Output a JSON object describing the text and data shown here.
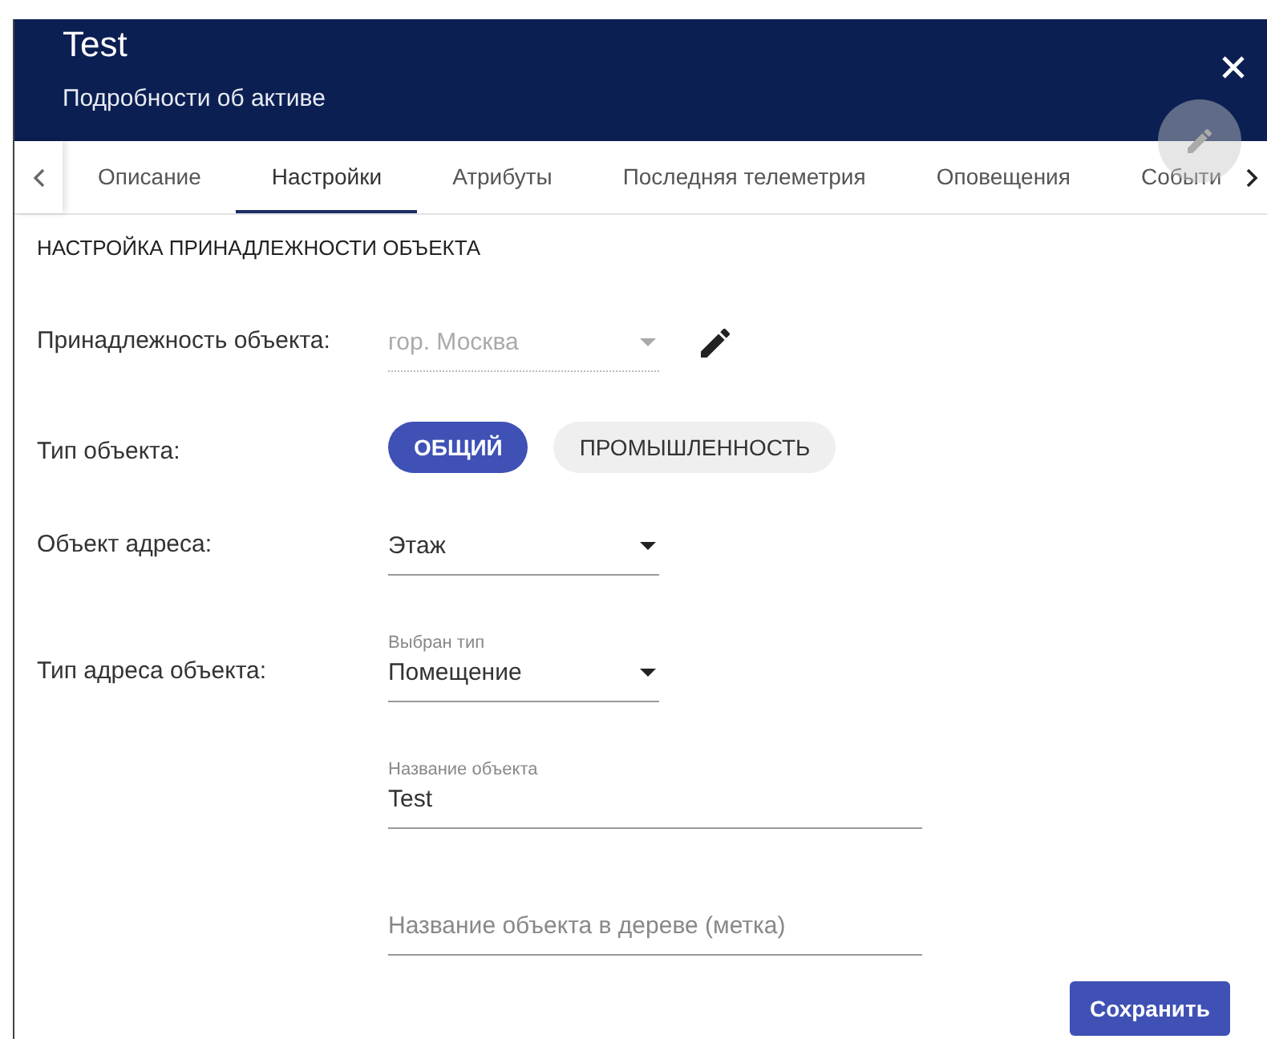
{
  "header": {
    "title": "Test",
    "subtitle": "Подробности об активе"
  },
  "tabs": [
    {
      "label": "Описание",
      "selected": false
    },
    {
      "label": "Настройки",
      "selected": true
    },
    {
      "label": "Атрибуты",
      "selected": false
    },
    {
      "label": "Последняя телеметрия",
      "selected": false
    },
    {
      "label": "Оповещения",
      "selected": false
    },
    {
      "label": "Событи",
      "selected": false
    }
  ],
  "section_title": "НАСТРОЙКА ПРИНАДЛЕЖНОСТИ ОБЪЕКТА",
  "rows": [
    {
      "kind": "select",
      "label": "Принадлежность объекта:",
      "value": "гор. Москва",
      "disabled": true,
      "editable": true
    },
    {
      "kind": "chips",
      "label": "Тип объекта:",
      "options": [
        {
          "label": "ОБЩИЙ",
          "selected": true
        },
        {
          "label": "ПРОМЫШЛЕННОСТЬ",
          "selected": false
        }
      ]
    },
    {
      "kind": "select",
      "label": "Объект адреса:",
      "value": "Этаж",
      "disabled": false
    },
    {
      "kind": "select",
      "label": "Тип адреса объекта:",
      "floating_label": "Выбран тип",
      "value": "Помещение",
      "disabled": false
    },
    {
      "kind": "text",
      "floating_label": "Название объекта",
      "value": "Test"
    },
    {
      "kind": "text",
      "placeholder": "Название объекта в дереве (метка)"
    }
  ],
  "save_button": "Сохранить"
}
